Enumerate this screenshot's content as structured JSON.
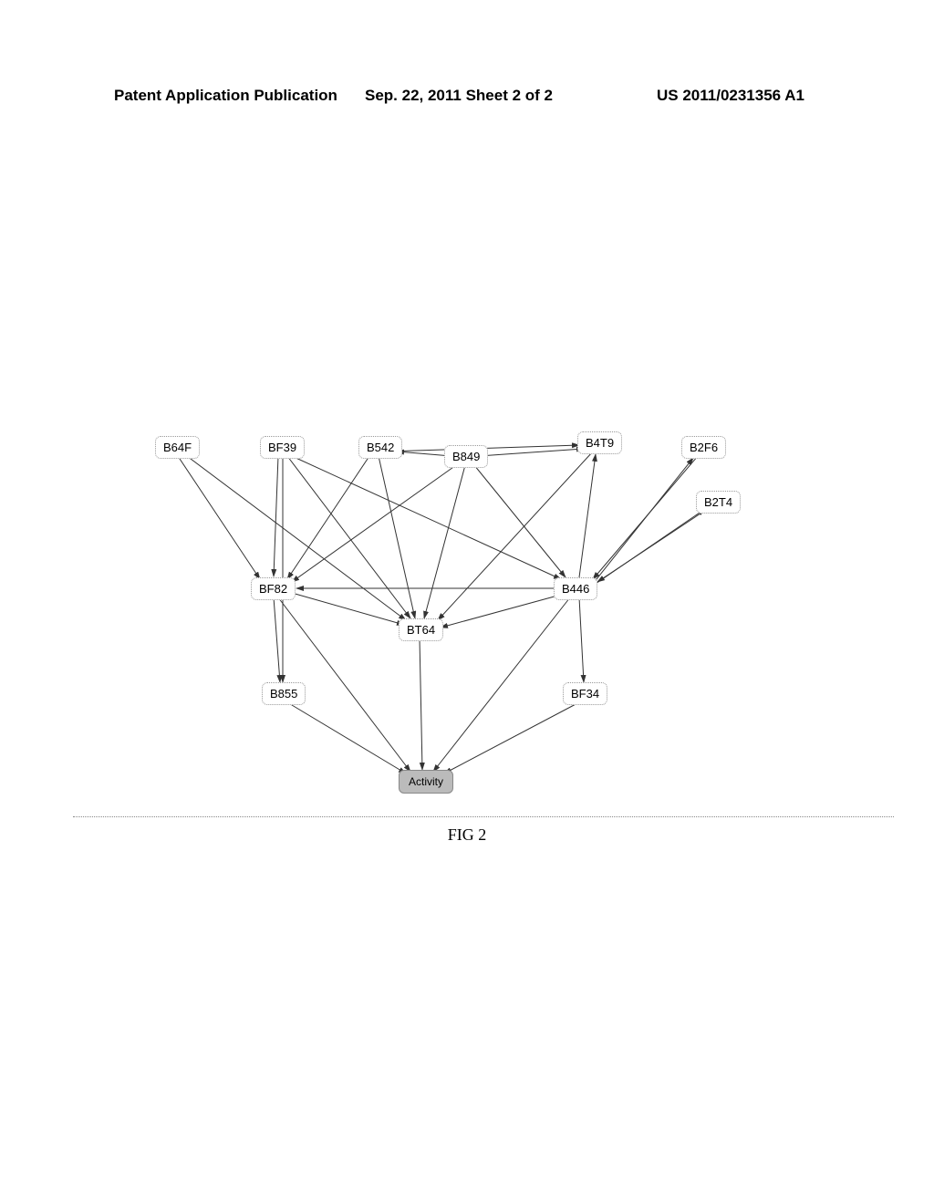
{
  "header": {
    "left": "Patent Application Publication",
    "center": "Sep. 22, 2011  Sheet 2 of 2",
    "right": "US 2011/0231356 A1"
  },
  "figure_label": "FIG 2",
  "nodes": {
    "B64F": "B64F",
    "BF39": "BF39",
    "B542": "B542",
    "B849": "B849",
    "B4T9": "B4T9",
    "B2F6": "B2F6",
    "B2T4": "B2T4",
    "BF82": "BF82",
    "BT64": "BT64",
    "B446": "B446",
    "B855": "B855",
    "BF34": "BF34",
    "Activity": "Activity"
  },
  "node_positions_comment": "positions are relative to diagram-container top-left",
  "edges": [
    [
      "B64F",
      "BF82"
    ],
    [
      "B64F",
      "BT64"
    ],
    [
      "BF39",
      "BF82"
    ],
    [
      "BF39",
      "BT64"
    ],
    [
      "BF39",
      "B446"
    ],
    [
      "BF39",
      "B855"
    ],
    [
      "B542",
      "BF82"
    ],
    [
      "B542",
      "B4T9"
    ],
    [
      "B542",
      "BT64"
    ],
    [
      "B849",
      "B542"
    ],
    [
      "B849",
      "BF82"
    ],
    [
      "B849",
      "BT64"
    ],
    [
      "B849",
      "B446"
    ],
    [
      "B849",
      "B4T9"
    ],
    [
      "B4T9",
      "BT64"
    ],
    [
      "B2F6",
      "B446"
    ],
    [
      "B2T4",
      "B446"
    ],
    [
      "BF82",
      "BT64"
    ],
    [
      "BF82",
      "B855"
    ],
    [
      "B446",
      "BF82"
    ],
    [
      "B446",
      "BT64"
    ],
    [
      "B446",
      "B4T9"
    ],
    [
      "B446",
      "BF34"
    ],
    [
      "B446",
      "B2F6"
    ],
    [
      "B446",
      "B2T4"
    ],
    [
      "B855",
      "Activity"
    ],
    [
      "BT64",
      "Activity"
    ],
    [
      "BF34",
      "Activity"
    ],
    [
      "BF82",
      "Activity"
    ],
    [
      "B446",
      "Activity"
    ]
  ]
}
